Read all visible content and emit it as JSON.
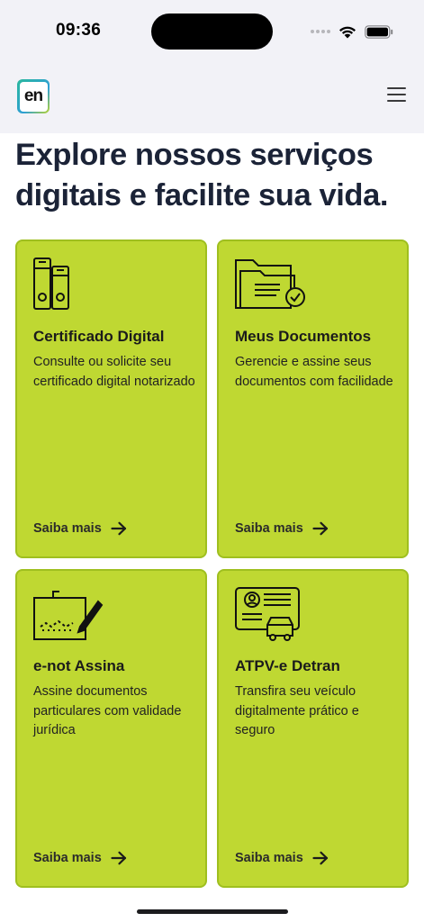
{
  "status_bar": {
    "time": "09:36"
  },
  "header": {
    "logo_text": "en"
  },
  "hero": {
    "title": "Explore nossos serviços digitais e facilite sua vida."
  },
  "cards": [
    {
      "title": "Certificado Digital",
      "description": "Consulte ou solicite seu certificado digital notarizado",
      "link": "Saiba mais",
      "icon": "binders-icon"
    },
    {
      "title": "Meus Documentos",
      "description": "Gerencie e assine seus documentos com facilidade",
      "link": "Saiba mais",
      "icon": "folder-check-icon"
    },
    {
      "title": "e-not Assina",
      "description": "Assine documentos particulares com validade jurídica",
      "link": "Saiba mais",
      "icon": "signature-pen-icon"
    },
    {
      "title": "ATPV-e Detran",
      "description": "Transfira seu veículo digitalmente prático e seguro",
      "link": "Saiba mais",
      "icon": "vehicle-document-icon"
    }
  ],
  "colors": {
    "card_background": "#bfd832",
    "card_border": "#9fbf1f",
    "title_color": "#1b2337"
  }
}
